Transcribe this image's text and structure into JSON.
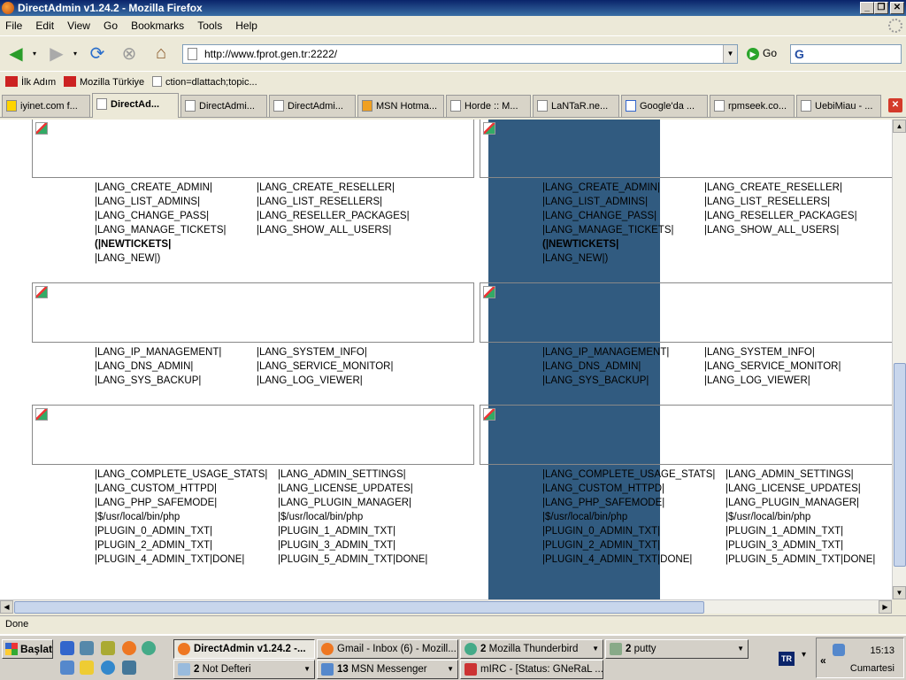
{
  "window": {
    "title": "DirectAdmin v1.24.2 - Mozilla Firefox",
    "minimize": "_",
    "restore": "❐",
    "close": "✕"
  },
  "menu": {
    "items": [
      "File",
      "Edit",
      "View",
      "Go",
      "Bookmarks",
      "Tools",
      "Help"
    ]
  },
  "nav": {
    "url": "http://www.fprot.gen.tr:2222/",
    "go_label": "Go",
    "search_value": "G"
  },
  "bookmarks": [
    {
      "label": "İlk Adım"
    },
    {
      "label": "Mozilla Türkiye"
    },
    {
      "label": "ction=dlattach;topic..."
    }
  ],
  "tabs": [
    {
      "label": "iyinet.com f..."
    },
    {
      "label": "DirectAd..."
    },
    {
      "label": "DirectAdmi..."
    },
    {
      "label": "DirectAdmi..."
    },
    {
      "label": "MSN Hotma..."
    },
    {
      "label": "Horde :: M..."
    },
    {
      "label": "LaNTaR.ne..."
    },
    {
      "label": "Google'da ..."
    },
    {
      "label": "rpmseek.co..."
    },
    {
      "label": "UebiMiau - ..."
    }
  ],
  "sections": [
    {
      "col1": [
        "|LANG_CREATE_ADMIN|",
        "|LANG_LIST_ADMINS|",
        "|LANG_CHANGE_PASS|",
        "|LANG_MANAGE_TICKETS|",
        "(|NEWTICKETS|",
        "|LANG_NEW|)"
      ],
      "col2": [
        "|LANG_CREATE_RESELLER|",
        "|LANG_LIST_RESELLERS|",
        "|LANG_RESELLER_PACKAGES|",
        "|LANG_SHOW_ALL_USERS|"
      ]
    },
    {
      "col1": [
        "|LANG_IP_MANAGEMENT|",
        "|LANG_DNS_ADMIN|",
        "|LANG_SYS_BACKUP|"
      ],
      "col2": [
        "|LANG_SYSTEM_INFO|",
        "|LANG_SERVICE_MONITOR|",
        "|LANG_LOG_VIEWER|"
      ]
    },
    {
      "col1": [
        "|LANG_COMPLETE_USAGE_STATS|",
        "|LANG_CUSTOM_HTTPD|",
        "|LANG_PHP_SAFEMODE|",
        "|$/usr/local/bin/php",
        "|PLUGIN_0_ADMIN_TXT|",
        "|PLUGIN_2_ADMIN_TXT|",
        "|PLUGIN_4_ADMIN_TXT|DONE|"
      ],
      "col2": [
        "|LANG_ADMIN_SETTINGS|",
        "|LANG_LICENSE_UPDATES|",
        "|LANG_PLUGIN_MANAGER|",
        "|$/usr/local/bin/php",
        "|PLUGIN_1_ADMIN_TXT|",
        "|PLUGIN_3_ADMIN_TXT|",
        "|PLUGIN_5_ADMIN_TXT|DONE|"
      ]
    }
  ],
  "status": "Done",
  "taskbar": {
    "start_label": "Başlat",
    "row1": [
      {
        "label": "DirectAdmin v1.24.2 -..."
      },
      {
        "label": "Gmail - Inbox (6) - Mozill..."
      },
      {
        "count": "2",
        "label": "Mozilla Thunderbird"
      },
      {
        "count": "2",
        "label": "putty"
      }
    ],
    "row2": [
      {
        "count": "2",
        "label": "Not Defteri"
      },
      {
        "count": "13",
        "label": "MSN Messenger"
      },
      {
        "label": "mIRC - [Status: GNeRaL ..."
      }
    ],
    "lang": "TR",
    "clock": "15:13",
    "day": "Cumartesi"
  },
  "colors": {
    "highlight": "#315b80",
    "titlebar": "#0a246a"
  }
}
